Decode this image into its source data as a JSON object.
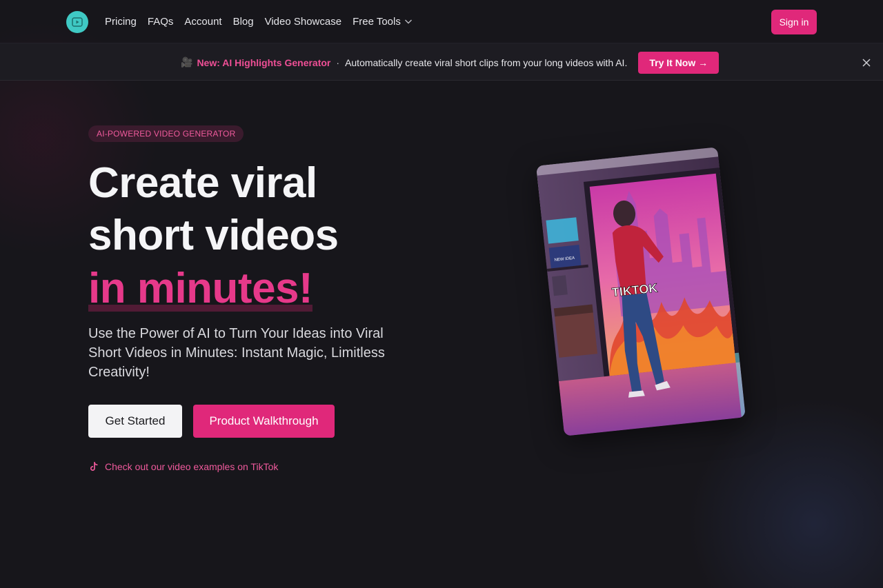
{
  "nav": {
    "items": [
      {
        "label": "Pricing"
      },
      {
        "label": "FAQs"
      },
      {
        "label": "Account"
      },
      {
        "label": "Blog"
      },
      {
        "label": "Video Showcase"
      },
      {
        "label": "Free Tools"
      }
    ],
    "signin_label": "Sign in"
  },
  "banner": {
    "emoji": "🎥",
    "title": "New: AI Highlights Generator",
    "separator": "·",
    "description": "Automatically create viral short clips from your long videos with AI.",
    "cta_label": "Try It Now →"
  },
  "hero": {
    "badge": "AI-POWERED VIDEO GENERATOR",
    "headline_line1": "Create viral",
    "headline_line2": "short videos",
    "headline_accent": "in minutes!",
    "subtitle": "Use the Power of AI to Turn Your Ideas into Viral Short Videos in Minutes: Instant Magic, Limitless Creativity!",
    "primary_button": "Get Started",
    "secondary_button": "Product Walkthrough",
    "tiktok_link": "Check out our video examples on TikTok"
  },
  "video_card": {
    "overlay_text": "TIKTOK",
    "screen_text": "NEW IDEA"
  },
  "colors": {
    "accent": "#e0287a",
    "background": "#17161b",
    "logo": "#3fc9c4"
  }
}
